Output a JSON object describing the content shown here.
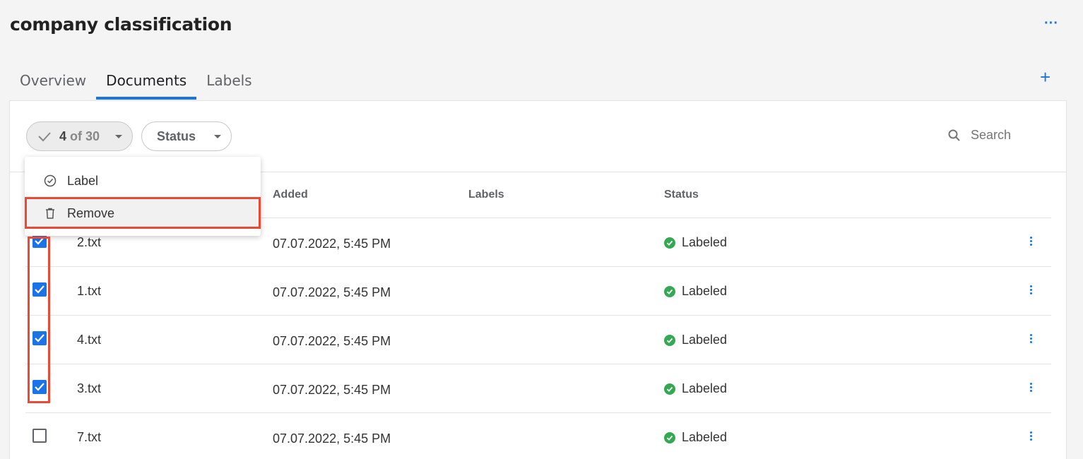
{
  "page": {
    "title": "company classification"
  },
  "header": {
    "more_icon": "more-horizontal-icon",
    "add_icon": "plus-icon"
  },
  "tabs": [
    {
      "label": "Overview",
      "active": false
    },
    {
      "label": "Documents",
      "active": true
    },
    {
      "label": "Labels",
      "active": false
    }
  ],
  "toolbar": {
    "selection_count": "4",
    "selection_total": "of 30",
    "status_filter": "Status",
    "search_placeholder": "Search"
  },
  "menu": {
    "items": [
      {
        "label": "Label",
        "icon": "check-circle-icon"
      },
      {
        "label": "Remove",
        "icon": "trash-icon"
      }
    ]
  },
  "table": {
    "headers": {
      "added": "Added",
      "labels": "Labels",
      "status": "Status"
    },
    "rows": [
      {
        "name": "2.txt",
        "added": "07.07.2022, 5:45 PM",
        "labels": "",
        "status": "Labeled",
        "checked": true
      },
      {
        "name": "1.txt",
        "added": "07.07.2022, 5:45 PM",
        "labels": "",
        "status": "Labeled",
        "checked": true
      },
      {
        "name": "4.txt",
        "added": "07.07.2022, 5:45 PM",
        "labels": "",
        "status": "Labeled",
        "checked": true
      },
      {
        "name": "3.txt",
        "added": "07.07.2022, 5:45 PM",
        "labels": "",
        "status": "Labeled",
        "checked": true
      },
      {
        "name": "7.txt",
        "added": "07.07.2022, 5:45 PM",
        "labels": "",
        "status": "Labeled",
        "checked": false
      }
    ]
  },
  "colors": {
    "accent": "#1a73e8",
    "success": "#34a853",
    "highlight": "#ea4a35"
  }
}
